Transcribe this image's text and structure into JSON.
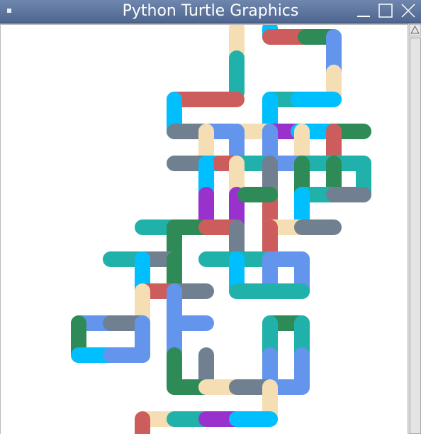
{
  "window": {
    "title": "Python Turtle Graphics"
  },
  "controls": {
    "menu_icon": "window-menu-icon",
    "minimize_icon": "minimize-icon",
    "maximize_icon": "maximize-icon",
    "close_icon": "close-icon"
  },
  "canvas": {
    "background": "#ffffff",
    "stroke_width_note": "thick rounded pipe segments",
    "palette": {
      "red": "#cd5c5c",
      "green": "#2e8b57",
      "tan": "#f5deb3",
      "teal": "#20b2aa",
      "cyan": "#00bfff",
      "blue": "#6495ed",
      "slate": "#708090",
      "purple": "#9932cc"
    }
  },
  "scrollbar": {
    "up_icon": "scroll-up-arrow-icon"
  }
}
